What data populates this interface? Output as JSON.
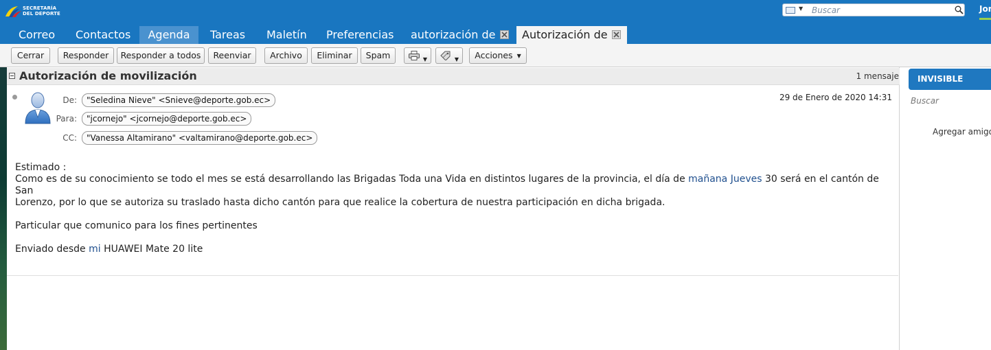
{
  "header": {
    "logo_line1": "SECRETARÍA",
    "logo_line2": "DEL DEPORTE",
    "search_placeholder": "Buscar",
    "user_name": "Jor"
  },
  "tabs": [
    {
      "label": "Correo"
    },
    {
      "label": "Contactos"
    },
    {
      "label": "Agenda"
    },
    {
      "label": "Tareas"
    },
    {
      "label": "Maletín"
    },
    {
      "label": "Preferencias"
    },
    {
      "label": "autorización de"
    },
    {
      "label": "Autorización de"
    }
  ],
  "toolbar": {
    "close": "Cerrar",
    "reply": "Responder",
    "reply_all": "Responder a todos",
    "forward": "Reenviar",
    "archive": "Archivo",
    "delete": "Eliminar",
    "spam": "Spam",
    "actions": "Acciones"
  },
  "conversation": {
    "title": "Autorización de movilización",
    "count": "1 mensaje"
  },
  "message": {
    "from_label": "De:",
    "to_label": "Para:",
    "cc_label": "CC:",
    "from": "\"Seledina Nieve\" <Snieve@deporte.gob.ec>",
    "to": "\"jcornejo\" <jcornejo@deporte.gob.ec>",
    "cc": "\"Vanessa Altamirano\" <valtamirano@deporte.gob.ec>",
    "date": "29 de Enero de 2020 14:31",
    "greeting": "Estimado :",
    "p1_a": "Como es de su conocimiento se todo el mes se está desarrollando las Brigadas Toda una Vida en distintos lugares de la provincia, el día de ",
    "p1_link": "mañana Jueves",
    "p1_b": " 30 será en el cantón de San",
    "p1_c": "Lorenzo, por lo que se autoriza su traslado hasta dicho cantón para que realice la cobertura de nuestra participación en dicha brigada.",
    "p2": "Particular que comunico para los fines pertinentes",
    "p3_a": "Enviado desde ",
    "p3_link": "mi",
    "p3_b": " HUAWEI Mate 20 lite"
  },
  "chat": {
    "status": "INVISIBLE",
    "search": "Buscar",
    "add": "Agregar amigo"
  },
  "colors": {
    "brand_blue": "#1976c0",
    "active_tab": "#4a92cf",
    "link": "#1f4f8e"
  }
}
